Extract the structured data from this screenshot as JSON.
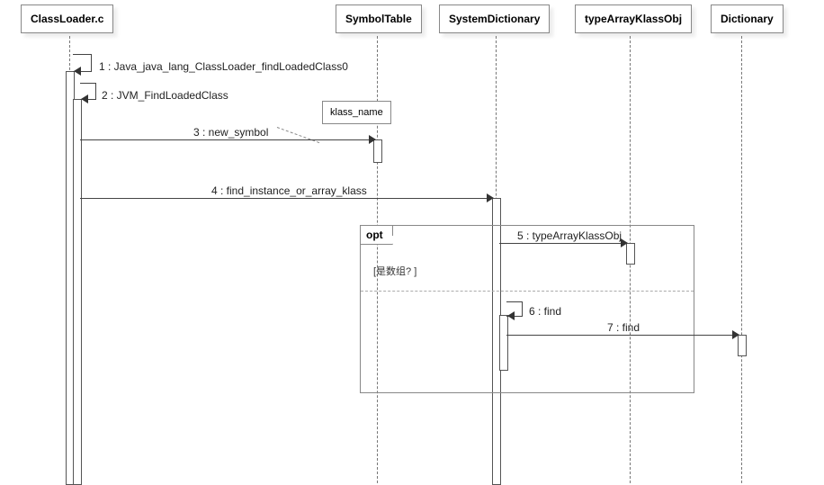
{
  "participants": {
    "p1": "ClassLoader.c",
    "p2": "SymbolTable",
    "p3": "SystemDictionary",
    "p4": "typeArrayKlassObj",
    "p5": "Dictionary"
  },
  "messages": {
    "m1": "1 : Java_java_lang_ClassLoader_findLoadedClass0",
    "m2": "2 : JVM_FindLoadedClass",
    "m3": "3 : new_symbol",
    "m4": "4 : find_instance_or_array_klass",
    "m5": "5 : typeArrayKlassObj",
    "m6": "6 : find",
    "m7": "7 : find"
  },
  "note": {
    "n1": "klass_name"
  },
  "fragment": {
    "label": "opt",
    "guard": "[是数组? ]"
  },
  "chart_data": {
    "type": "sequence-diagram",
    "participants": [
      "ClassLoader.c",
      "SymbolTable",
      "SystemDictionary",
      "typeArrayKlassObj",
      "Dictionary"
    ],
    "messages": [
      {
        "seq": 1,
        "from": "ClassLoader.c",
        "to": "ClassLoader.c",
        "label": "Java_java_lang_ClassLoader_findLoadedClass0",
        "self": true
      },
      {
        "seq": 2,
        "from": "ClassLoader.c",
        "to": "ClassLoader.c",
        "label": "JVM_FindLoadedClass",
        "self": true
      },
      {
        "seq": 3,
        "from": "ClassLoader.c",
        "to": "SymbolTable",
        "label": "new_symbol",
        "note": "klass_name"
      },
      {
        "seq": 4,
        "from": "ClassLoader.c",
        "to": "SystemDictionary",
        "label": "find_instance_or_array_klass"
      },
      {
        "seq": 5,
        "from": "SystemDictionary",
        "to": "typeArrayKlassObj",
        "label": "typeArrayKlassObj",
        "fragment": "opt",
        "guard": "是数组?"
      },
      {
        "seq": 6,
        "from": "SystemDictionary",
        "to": "SystemDictionary",
        "label": "find",
        "self": true,
        "fragment": "opt-else"
      },
      {
        "seq": 7,
        "from": "SystemDictionary",
        "to": "Dictionary",
        "label": "find",
        "fragment": "opt-else"
      }
    ],
    "fragments": [
      {
        "type": "opt",
        "guard": "[是数组? ]",
        "covers_messages": [
          5,
          6,
          7
        ],
        "divider_after": [
          5
        ]
      }
    ]
  }
}
